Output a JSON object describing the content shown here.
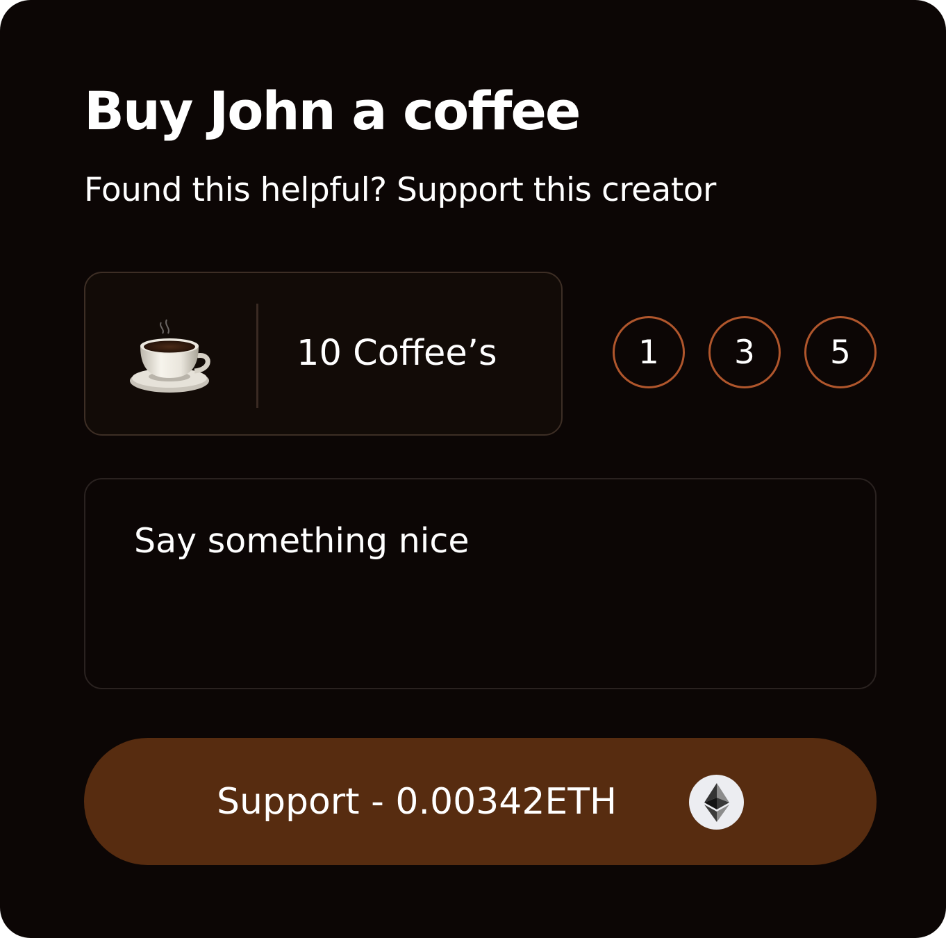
{
  "header": {
    "title": "Buy John a coffee",
    "subtitle": "Found this helpful? Support this creator"
  },
  "quantity": {
    "icon": "coffee-cup-icon",
    "label": "10 Coffee’s",
    "options": [
      "1",
      "3",
      "5"
    ]
  },
  "message": {
    "placeholder": "Say something nice"
  },
  "support": {
    "label": "Support - 0.00342ETH",
    "icon": "ethereum-icon"
  },
  "colors": {
    "background": "#0c0605",
    "accent_border": "#b0562c",
    "button": "#572c10",
    "text": "#ffffff"
  }
}
